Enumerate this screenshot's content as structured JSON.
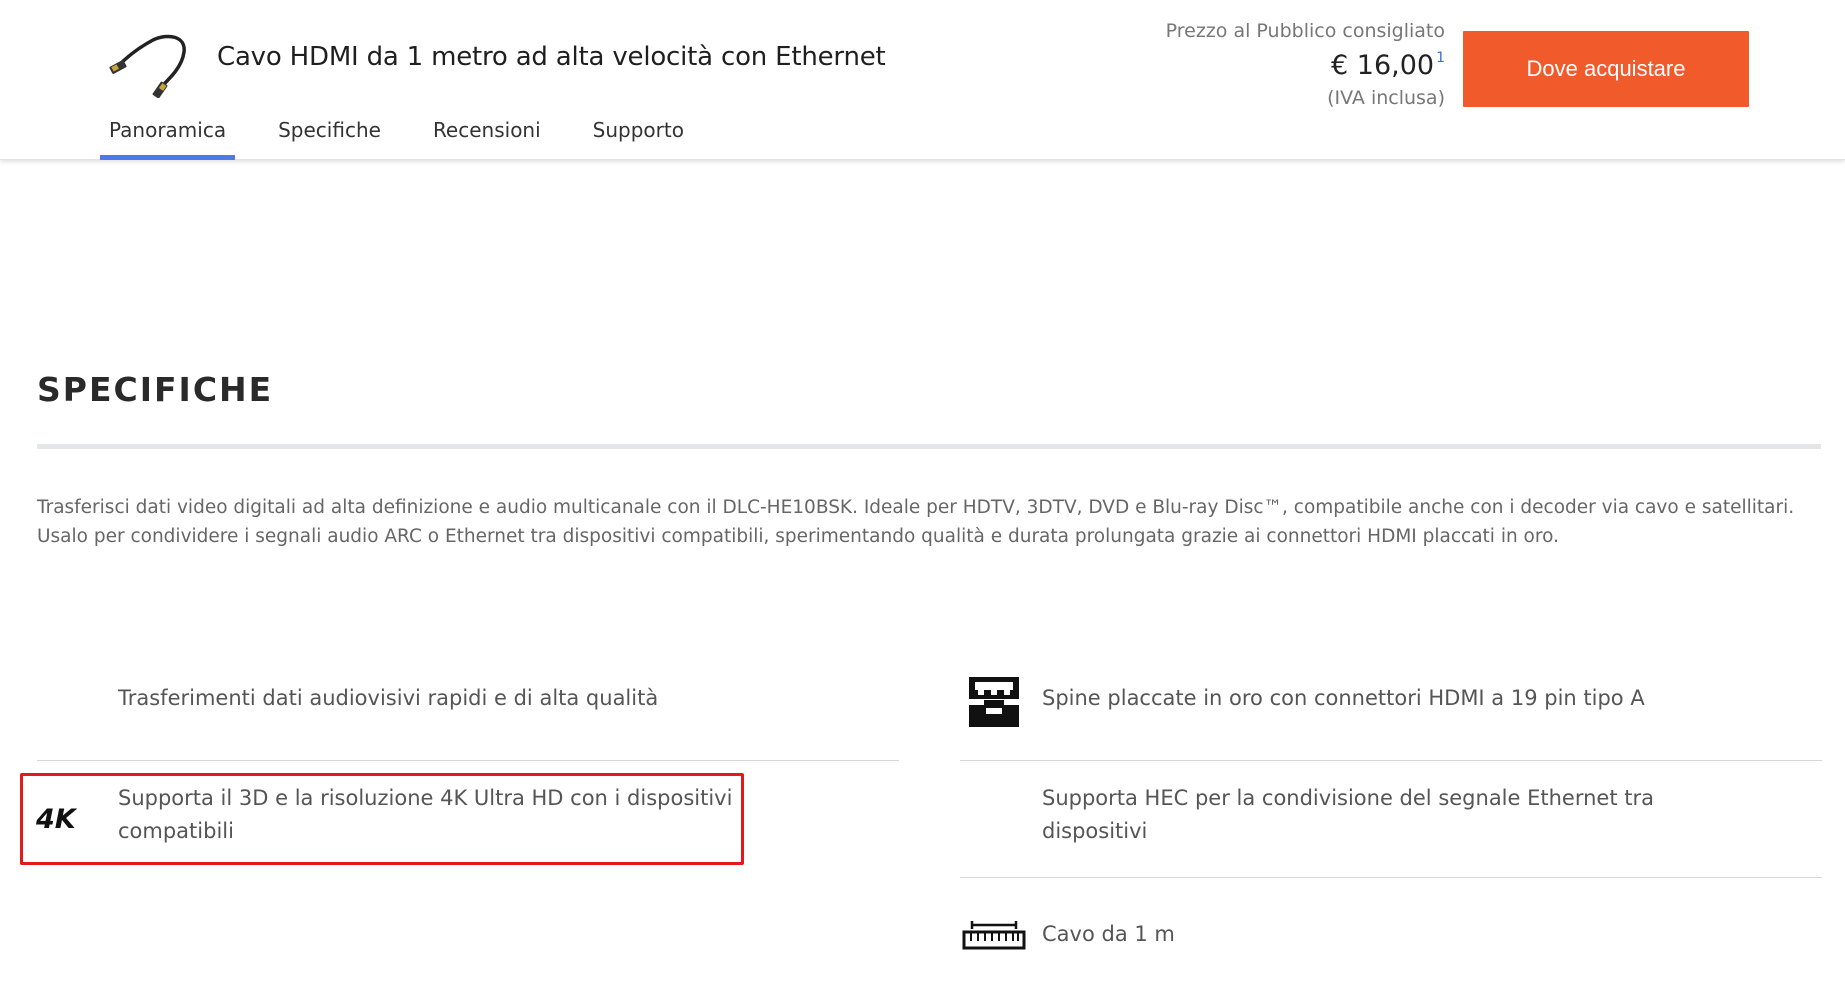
{
  "header": {
    "product_title": "Cavo HDMI da 1 metro ad alta velocità con Ethernet",
    "tabs": [
      {
        "label": "Panoramica",
        "active": true
      },
      {
        "label": "Specifiche",
        "active": false
      },
      {
        "label": "Recensioni",
        "active": false
      },
      {
        "label": "Supporto",
        "active": false
      }
    ],
    "price": {
      "label": "Prezzo al Pubblico consigliato",
      "value": "€ 16,00",
      "footnote": "1",
      "vat_note": "(IVA inclusa)"
    },
    "buy_button_label": "Dove acquistare",
    "tab_active_color": "#4a7be6",
    "buy_button_color": "#f15a2b"
  },
  "specs": {
    "title": "SPECIFICHE",
    "description": "Trasferisci dati video digitali ad alta definizione e audio multicanale con il DLC-HE10BSK. Ideale per HDTV, 3DTV, DVD e Blu-ray Disc™, compatibile anche con i decoder via cavo e satellitari. Usalo per condividere i segnali audio ARC o Ethernet tra dispositivi compatibili, sperimentando qualità e durata prolungata grazie ai connettori HDMI placcati in oro.",
    "features": [
      {
        "text": "Trasferimenti dati audiovisivi rapidi e di alta qualità",
        "icon": "none"
      },
      {
        "text": "Spine placcate in oro con connettori HDMI a 19 pin tipo A",
        "icon": "hdmi-connector-icon"
      },
      {
        "text": "Supporta il 3D e la risoluzione 4K Ultra HD con i dispositivi compatibili",
        "icon": "4k-icon",
        "icon_text": "4K",
        "highlighted": true
      },
      {
        "text": "Supporta HEC per la condivisione del segnale Ethernet tra dispositivi",
        "icon": "none"
      },
      {
        "text": "Cavo da 1 m",
        "icon": "ruler-icon"
      }
    ],
    "highlight_color": "#e21a1a"
  }
}
